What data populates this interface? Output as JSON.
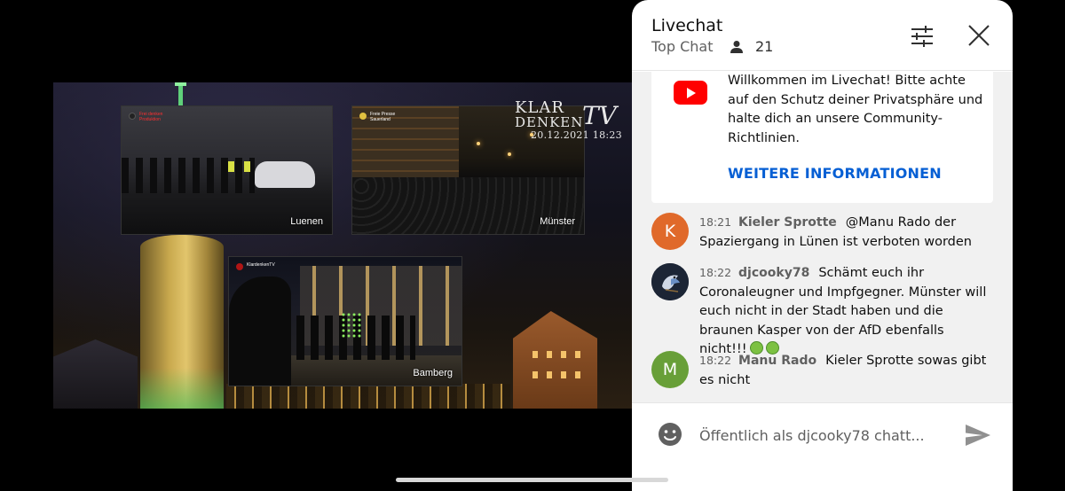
{
  "video": {
    "logo": {
      "line1": "KLAR",
      "line2": "DENKEN",
      "tv": "TV"
    },
    "timestamp": "20.12.2021 18:23",
    "insets": [
      {
        "label": "Luenen",
        "brand_lines": "Frei denken\nProduktion"
      },
      {
        "label": "Münster",
        "brand_lines": "Freie Presse\nSauerland"
      },
      {
        "label": "Bamberg",
        "brand_lines": "KlardenkenTV"
      }
    ]
  },
  "chat": {
    "title": "Livechat",
    "mode": "Top Chat",
    "viewer_count": "21",
    "welcome": {
      "text": "Willkommen im Livechat! Bitte achte auf den Schutz deiner Privatsphäre und halte dich an unsere Community-Richtlinien.",
      "link": "WEITERE INFORMATIONEN"
    },
    "messages": [
      {
        "time": "18:21",
        "author": "Kieler Sprotte",
        "avatar_letter": "K",
        "avatar_color": "#e0692a",
        "text": "@Manu Rado der Spaziergang in Lünen ist verboten worden"
      },
      {
        "time": "18:22",
        "author": "djcooky78",
        "avatar_letter": "",
        "avatar_color": "#1c2535",
        "text": "Schämt euch ihr Coronaleugner und Impfgegner. Münster will euch nicht in der Stadt haben und die braunen Kasper von der AfD ebenfalls nicht!!!"
      },
      {
        "time": "18:22",
        "author": "Manu Rado",
        "avatar_letter": "M",
        "avatar_color": "#689f38",
        "text": "Kieler Sprotte sowas gibt es nicht"
      }
    ],
    "input_placeholder": "Öffentlich als djcooky78 chatt..."
  }
}
